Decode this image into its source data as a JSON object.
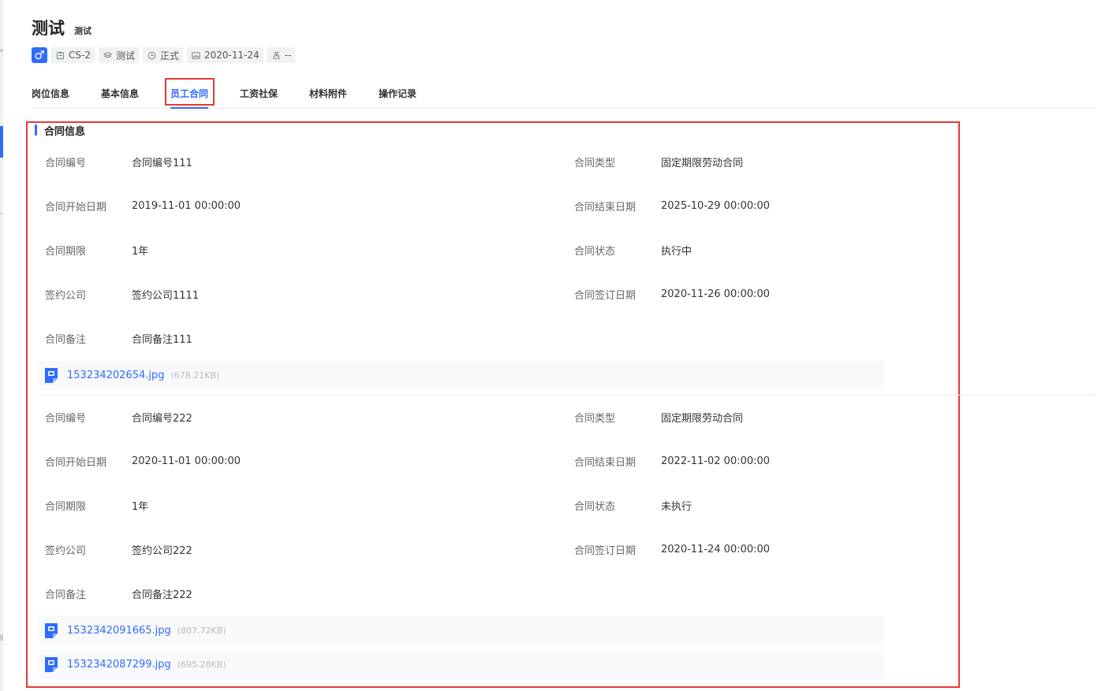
{
  "employee": {
    "name": "测试",
    "sub": "测试",
    "gender_symbol": "♂",
    "tags": [
      {
        "icon": "id-card-icon",
        "text": "CS-2"
      },
      {
        "icon": "layers-icon",
        "text": "测试"
      },
      {
        "icon": "clock-icon",
        "text": "正式"
      },
      {
        "icon": "image-icon",
        "text": "2020-11-24"
      },
      {
        "icon": "org-icon",
        "text": "--"
      }
    ]
  },
  "tabs": [
    {
      "label": "岗位信息",
      "active": false
    },
    {
      "label": "基本信息",
      "active": false
    },
    {
      "label": "员工合同",
      "active": true
    },
    {
      "label": "工资社保",
      "active": false
    },
    {
      "label": "材料附件",
      "active": false
    },
    {
      "label": "操作记录",
      "active": false
    }
  ],
  "section": {
    "title": "合同信息"
  },
  "labels": {
    "contract_no": "合同编号",
    "contract_type": "合同类型",
    "start_date": "合同开始日期",
    "end_date": "合同结束日期",
    "term": "合同期限",
    "status": "合同状态",
    "company": "签约公司",
    "sign_date": "合同签订日期",
    "remark": "合同备注"
  },
  "contracts": [
    {
      "contract_no": "合同编号111",
      "contract_type": "固定期限劳动合同",
      "start_date": "2019-11-01 00:00:00",
      "end_date": "2025-10-29 00:00:00",
      "term": "1年",
      "status": "执行中",
      "company": "签约公司1111",
      "sign_date": "2020-11-26 00:00:00",
      "remark": "合同备注111",
      "files": [
        {
          "name": "153234202654.jpg",
          "size": "(678.21KB)"
        }
      ]
    },
    {
      "contract_no": "合同编号222",
      "contract_type": "固定期限劳动合同",
      "start_date": "2020-11-01 00:00:00",
      "end_date": "2022-11-02 00:00:00",
      "term": "1年",
      "status": "未执行",
      "company": "签约公司222",
      "sign_date": "2020-11-24 00:00:00",
      "remark": "合同备注222",
      "files": [
        {
          "name": "1532342091665.jpg",
          "size": "(807.72KB)"
        },
        {
          "name": "1532342087299.jpg",
          "size": "(695.28KB)"
        }
      ]
    }
  ],
  "colors": {
    "accent": "#2f6bff",
    "highlight": "#e53935"
  }
}
